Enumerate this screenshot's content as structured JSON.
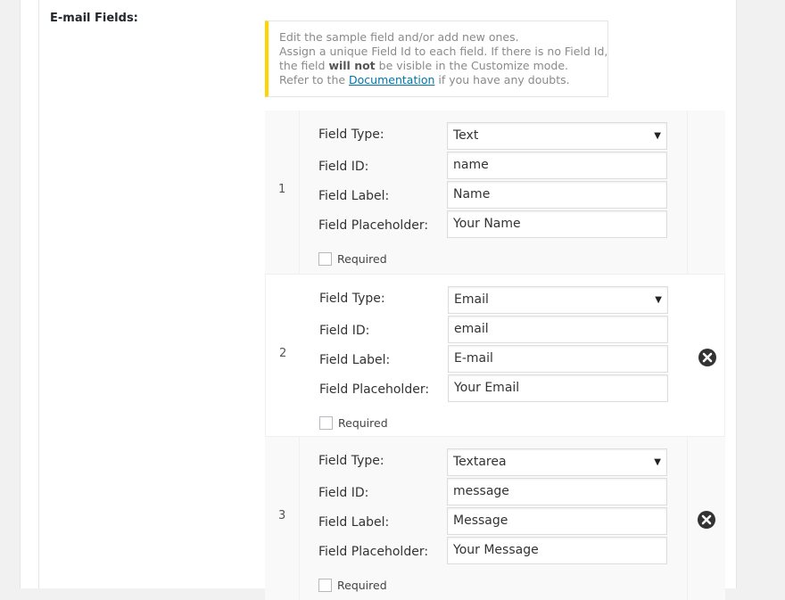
{
  "section": {
    "title": "E-mail Fields:"
  },
  "notice": {
    "line1": "Edit the sample field and/or add new ones.",
    "line2": "Assign a unique Field Id to each field. If there is no Field Id,",
    "line3_pre": "the field ",
    "line3_bold": "will not",
    "line3_post": " be visible in the Customize mode.",
    "line4_pre": "Refer to the ",
    "line4_link": "Documentation",
    "line4_post": " if you have any doubts.",
    "accent_color": "#ffd400"
  },
  "labels": {
    "type": "Field Type:",
    "id": "Field ID:",
    "label": "Field Label:",
    "placeholder": "Field Placeholder:",
    "required": "Required"
  },
  "fields": [
    {
      "number": "1",
      "type": "Text",
      "id": "name",
      "label": "Name",
      "placeholder": "Your Name",
      "removable": false
    },
    {
      "number": "2",
      "type": "Email",
      "id": "email",
      "label": "E-mail",
      "placeholder": "Your Email",
      "removable": true
    },
    {
      "number": "3",
      "type": "Textarea",
      "id": "message",
      "label": "Message",
      "placeholder": "Your Message",
      "removable": true
    }
  ],
  "icons": {
    "remove": "close-circle-icon",
    "dropdown": "chevron-down-icon"
  }
}
